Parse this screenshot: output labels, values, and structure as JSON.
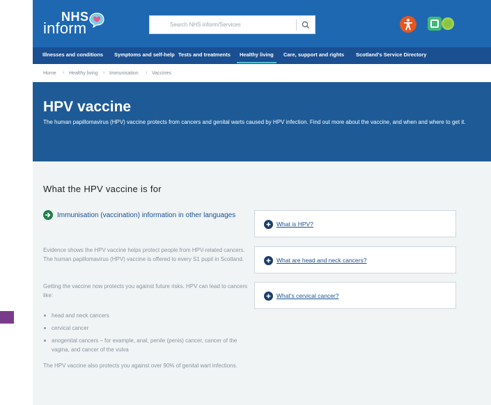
{
  "logo": {
    "nhs": "NHS",
    "inform": "inform"
  },
  "search": {
    "placeholder": "Search NHS inform/Services"
  },
  "nav": {
    "items": [
      {
        "label": "Illnesses and conditions"
      },
      {
        "label": "Symptoms and self-help"
      },
      {
        "label": "Tests and treatments"
      },
      {
        "label": "Healthy living"
      },
      {
        "label": "Care, support and rights"
      },
      {
        "label": "Scotland's Service Directory"
      }
    ]
  },
  "breadcrumb": [
    "Home",
    "Healthy living",
    "Immunisation",
    "Vaccines"
  ],
  "hero": {
    "title": "HPV vaccine",
    "intro": "The human papillomavirus (HPV) vaccine protects from cancers and genital warts caused by HPV infection. Find out more about the vaccine, and when and where to get it."
  },
  "main": {
    "section_title": "What the HPV vaccine is for",
    "lang_link": "Immunisation (vaccination) information in other languages",
    "para1": "Evidence shows the HPV vaccine helps protect people from HPV-related cancers. The human papillomavirus (HPV) vaccine is offered to every S1 pupil in Scotland.",
    "para2": "Getting the vaccine now protects you against future risks. HPV can lead to cancers like:",
    "bullets": [
      "head and neck cancers",
      "cervical cancer",
      "anogenital cancers – for example, anal, penile (penis) cancer, cancer of the vagina, and cancer of the vulva"
    ],
    "para3": "The HPV vaccine also protects you against over 90% of genital wart infections."
  },
  "accordions": [
    {
      "label": "What is HPV?"
    },
    {
      "label": "What are head and neck cancers?"
    },
    {
      "label": "What's cervical cancer?"
    }
  ],
  "colors": {
    "header": "#1e68b2",
    "nav": "#1a4f91",
    "hero": "#1e5b96",
    "accessibility": "#e8561f",
    "language": "#40b87a"
  },
  "icons": [
    "speech-bubble-icon",
    "search-icon",
    "accessibility-icon",
    "language-icon",
    "arrow-right-circle-icon",
    "plus-circle-icon"
  ]
}
